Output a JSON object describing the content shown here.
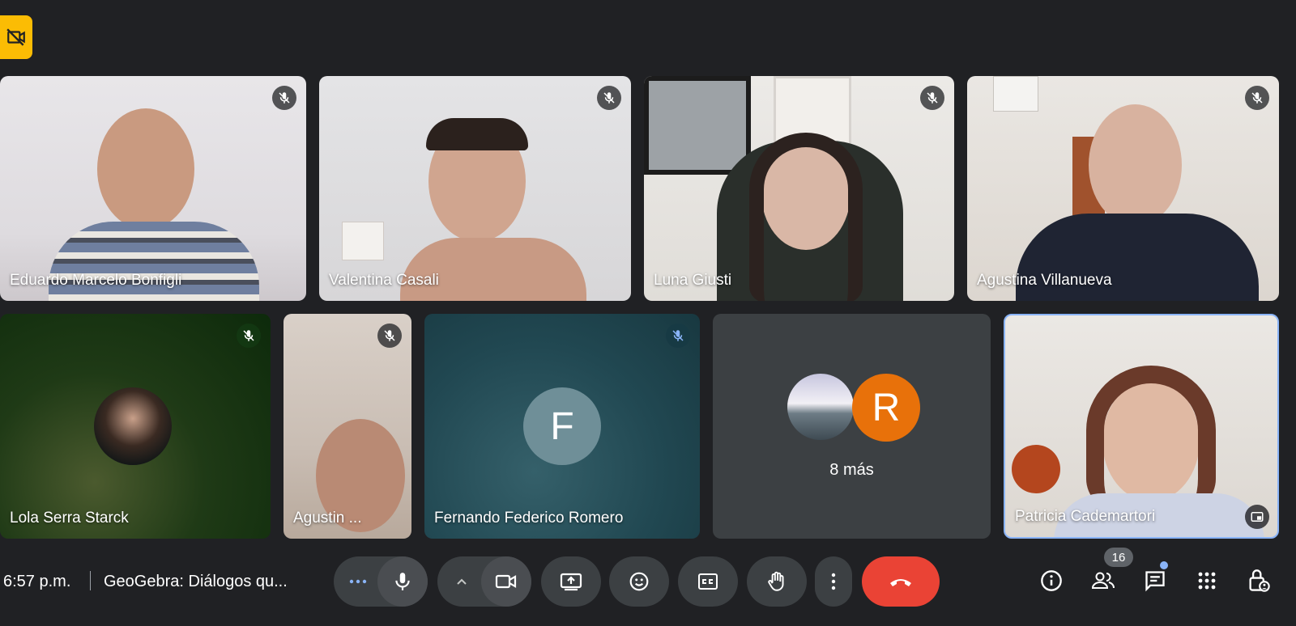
{
  "participants": [
    {
      "name": "Eduardo Marcelo Bonfigli"
    },
    {
      "name": "Valentina Casali"
    },
    {
      "name": "Luna Giusti"
    },
    {
      "name": "Agustina Villanueva"
    },
    {
      "name": "Lola Serra Starck"
    },
    {
      "name": "Agustin ..."
    },
    {
      "name": "Fernando Federico Romero",
      "initial": "F"
    },
    {
      "name": "Patricia Cademartori"
    }
  ],
  "more_tile": {
    "label": "8 más",
    "avatar_initial": "R"
  },
  "meeting": {
    "time": "6:57 p.m.",
    "title": "GeoGebra: Diálogos qu..."
  },
  "participants_count": "16",
  "colors": {
    "background": "#202124",
    "control": "#3c4043",
    "end_call": "#ea4335",
    "badge": "#fbbc04",
    "accent": "#8ab4f8"
  }
}
